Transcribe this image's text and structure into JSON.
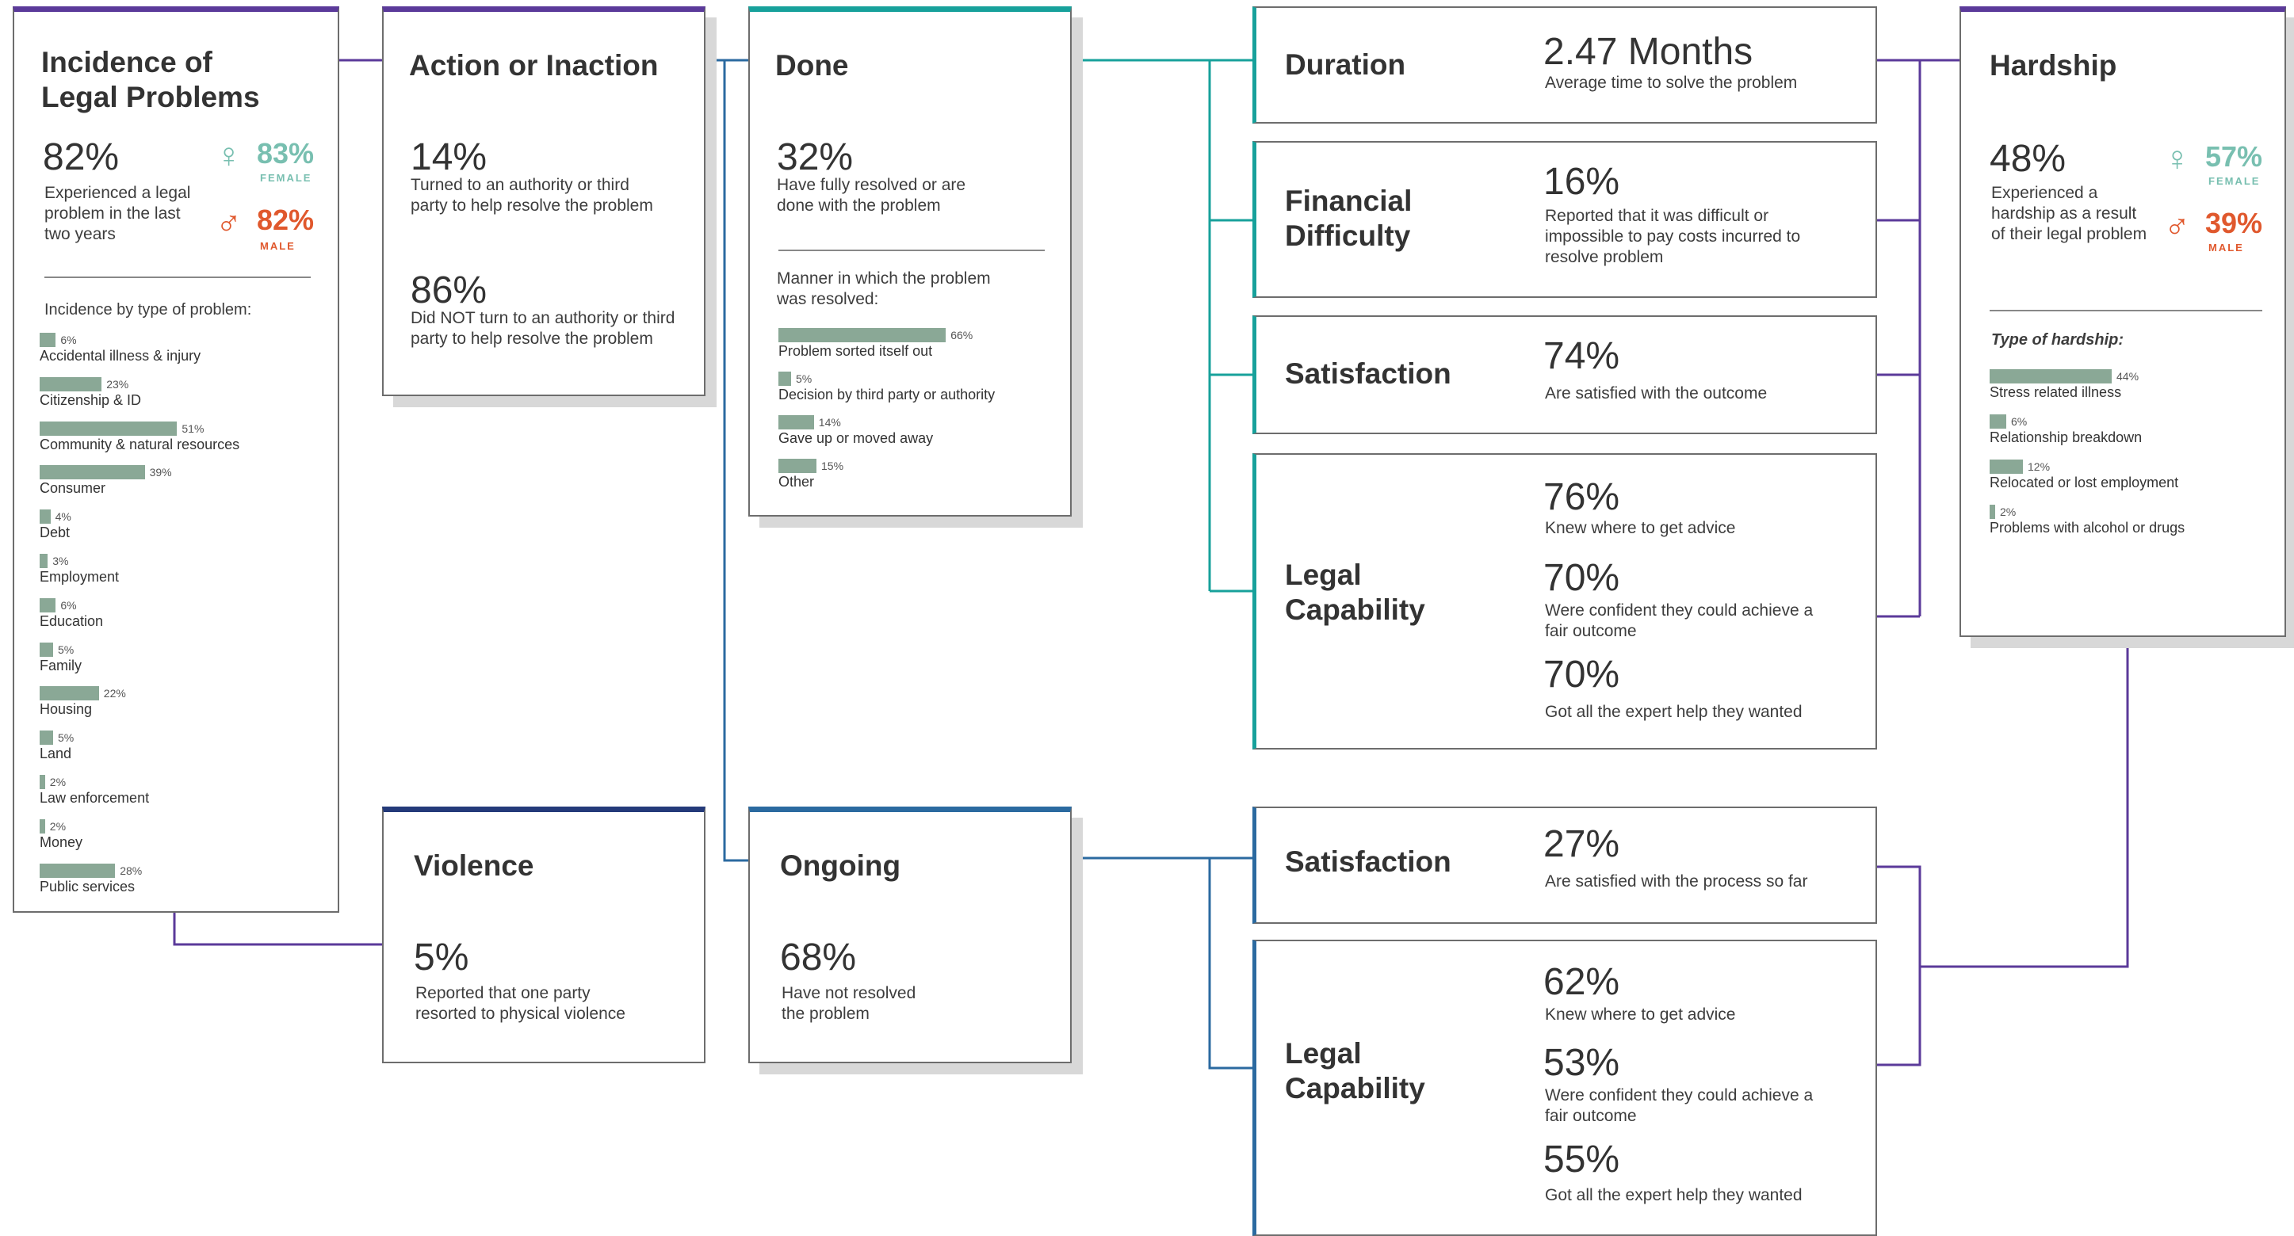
{
  "incidence": {
    "title_line1": "Incidence of",
    "title_line2": "Legal Problems",
    "value": "82%",
    "desc_line1": "Experienced a legal",
    "desc_line2": "problem in the last",
    "desc_line3": "two years",
    "female_value": "83%",
    "female_label": "FEMALE",
    "male_value": "82%",
    "male_label": "MALE",
    "by_type_heading": "Incidence by type of problem:",
    "types": [
      {
        "label": "Accidental illness & injury",
        "value": 6,
        "display": "6%"
      },
      {
        "label": "Citizenship & ID",
        "value": 23,
        "display": "23%"
      },
      {
        "label": "Community & natural resources",
        "value": 51,
        "display": "51%"
      },
      {
        "label": "Consumer",
        "value": 39,
        "display": "39%"
      },
      {
        "label": "Debt",
        "value": 4,
        "display": "4%"
      },
      {
        "label": "Employment",
        "value": 3,
        "display": "3%"
      },
      {
        "label": "Education",
        "value": 6,
        "display": "6%"
      },
      {
        "label": "Family",
        "value": 5,
        "display": "5%"
      },
      {
        "label": "Housing",
        "value": 22,
        "display": "22%"
      },
      {
        "label": "Land",
        "value": 5,
        "display": "5%"
      },
      {
        "label": "Law enforcement",
        "value": 2,
        "display": "2%"
      },
      {
        "label": "Money",
        "value": 2,
        "display": "2%"
      },
      {
        "label": "Public services",
        "value": 28,
        "display": "28%"
      }
    ]
  },
  "action": {
    "title": "Action or Inaction",
    "value1": "14%",
    "desc1_line1": "Turned to an authority or third",
    "desc1_line2": "party to help resolve the problem",
    "value2": "86%",
    "desc2_line1": "Did NOT turn to an authority or third",
    "desc2_line2": "party to help resolve the problem"
  },
  "done": {
    "title": "Done",
    "value": "32%",
    "desc_line1": "Have fully resolved or are",
    "desc_line2": "done with the problem",
    "manner_line1": "Manner in which the problem",
    "manner_line2": "was resolved:",
    "manners": [
      {
        "label": "Problem sorted itself out",
        "value": 66,
        "display": "66%"
      },
      {
        "label": "Decision by third party or authority",
        "value": 5,
        "display": "5%"
      },
      {
        "label": "Gave up or moved away",
        "value": 14,
        "display": "14%"
      },
      {
        "label": "Other",
        "value": 15,
        "display": "15%"
      }
    ]
  },
  "violence": {
    "title": "Violence",
    "value": "5%",
    "desc_line1": "Reported that one party",
    "desc_line2": "resorted to physical violence"
  },
  "ongoing": {
    "title": "Ongoing",
    "value": "68%",
    "desc_line1": "Have not resolved",
    "desc_line2": "the problem"
  },
  "done_outcomes": {
    "duration": {
      "label": "Duration",
      "value": "2.47 Months",
      "desc": "Average time to solve the problem"
    },
    "financial": {
      "label_line1": "Financial",
      "label_line2": "Difficulty",
      "value": "16%",
      "desc_line1": "Reported that it was difficult or",
      "desc_line2": "impossible to pay costs incurred to",
      "desc_line3": "resolve problem"
    },
    "satisfaction": {
      "label": "Satisfaction",
      "value": "74%",
      "desc": "Are satisfied with the outcome"
    },
    "capability": {
      "label_line1": "Legal",
      "label_line2": "Capability",
      "value1": "76%",
      "desc1": "Knew where to get advice",
      "value2": "70%",
      "desc2_line1": "Were confident they could achieve a",
      "desc2_line2": "fair outcome",
      "value3": "70%",
      "desc3": "Got all the expert help they wanted"
    }
  },
  "ongoing_outcomes": {
    "satisfaction": {
      "label": "Satisfaction",
      "value": "27%",
      "desc": "Are satisfied with the process so far"
    },
    "capability": {
      "label_line1": "Legal",
      "label_line2": "Capability",
      "value1": "62%",
      "desc1": "Knew where to get advice",
      "value2": "53%",
      "desc2_line1": "Were confident they could achieve a",
      "desc2_line2": "fair outcome",
      "value3": "55%",
      "desc3": "Got all the expert help they wanted"
    }
  },
  "hardship": {
    "title": "Hardship",
    "value": "48%",
    "desc_line1": "Experienced a",
    "desc_line2": "hardship as a result",
    "desc_line3": "of their legal problem",
    "female_value": "57%",
    "female_label": "FEMALE",
    "male_value": "39%",
    "male_label": "MALE",
    "type_heading": "Type of hardship:",
    "types": [
      {
        "label": "Stress related illness",
        "value": 44,
        "display": "44%"
      },
      {
        "label": "Relationship breakdown",
        "value": 6,
        "display": "6%"
      },
      {
        "label": "Relocated or lost employment",
        "value": 12,
        "display": "12%"
      },
      {
        "label": "Problems with alcohol or drugs",
        "value": 2,
        "display": "2%"
      }
    ]
  },
  "colors": {
    "purple": "#5b3a9a",
    "teal": "#17a19b",
    "navy": "#243a7a",
    "blue": "#2b6aa0",
    "bar": "#8aa896",
    "female": "#78bfb0",
    "male": "#e0582d"
  }
}
